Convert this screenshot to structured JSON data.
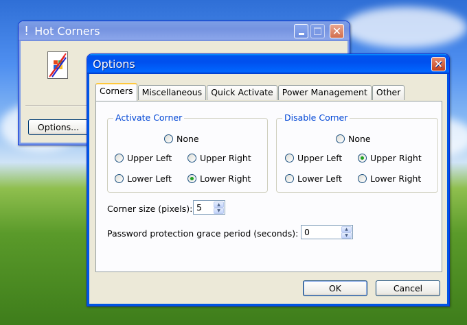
{
  "hot_corners": {
    "title": "Hot Corners",
    "title_icon": "exclamation-icon",
    "options_button": "Options..."
  },
  "dialog": {
    "title": "Options",
    "tabs": [
      "Corners",
      "Miscellaneous",
      "Quick Activate",
      "Power Management",
      "Other"
    ],
    "active_tab": "Corners",
    "activate_group": {
      "label": "Activate Corner",
      "options": [
        "None",
        "Upper Left",
        "Upper Right",
        "Lower Left",
        "Lower Right"
      ],
      "selected": "Lower Right"
    },
    "disable_group": {
      "label": "Disable Corner",
      "options": [
        "None",
        "Upper Left",
        "Upper Right",
        "Lower Left",
        "Lower Right"
      ],
      "selected": "Upper Right"
    },
    "corner_size_label": "Corner size (pixels):",
    "corner_size_value": "5",
    "grace_label": "Password protection grace period (seconds):",
    "grace_value": "0",
    "ok": "OK",
    "cancel": "Cancel"
  },
  "colors": {
    "title_active": "#0054e3",
    "group_label": "#0046d5",
    "radio_dot": "#21a121"
  }
}
